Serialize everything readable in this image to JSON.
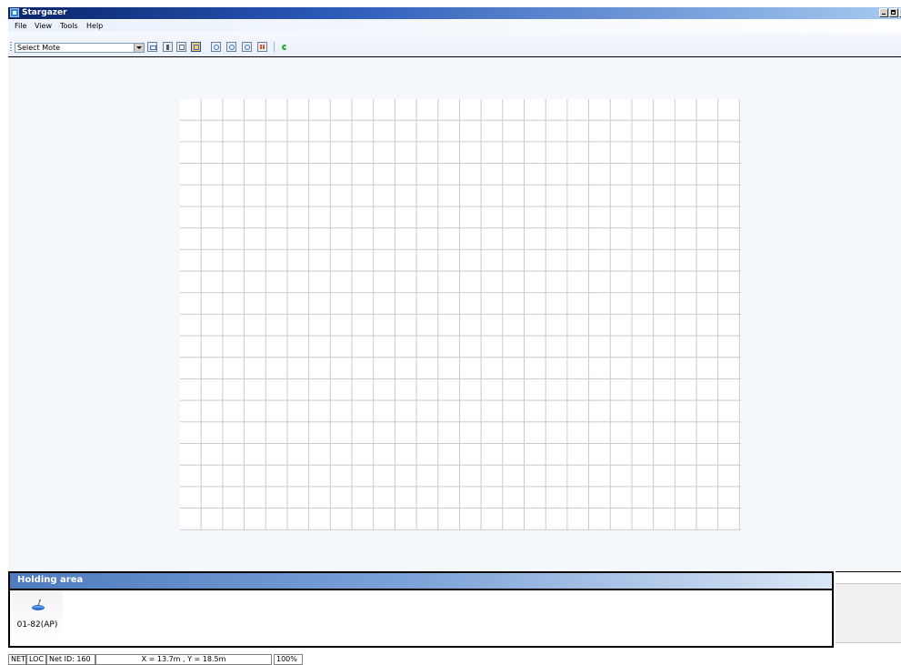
{
  "window": {
    "title": "Stargazer"
  },
  "menu": {
    "items": [
      "File",
      "View",
      "Tools",
      "Help"
    ]
  },
  "toolbar": {
    "select_value": "Select Mote",
    "buttons": [
      {
        "name": "rectangle-tool-icon",
        "color": "#4a6fb0"
      },
      {
        "name": "tower-icon",
        "color": "#5b5b5b"
      },
      {
        "name": "fit-view-icon",
        "color": "#6b6b6b"
      },
      {
        "name": "layout-icon",
        "color": "#3a78c2",
        "active": true
      },
      {
        "name": "zoom-in-icon",
        "color": "#3a78c2"
      },
      {
        "name": "zoom-out-icon",
        "color": "#3a78c2"
      },
      {
        "name": "zoom-fit-icon",
        "color": "#3a78c2"
      },
      {
        "name": "chart-icon",
        "color": "#d65a1f"
      },
      {
        "name": "refresh-icon",
        "color": "#2aa23a"
      }
    ]
  },
  "holding_area": {
    "title": "Holding area",
    "motes": [
      {
        "label": "01-82(AP)",
        "icon": "access-point-icon",
        "color": "#2d6fd0"
      }
    ]
  },
  "statusbar": {
    "net": "NET",
    "loc": "LOC",
    "net_id": "Net ID: 160",
    "coords": "X = 13.7m , Y = 18.5m",
    "zoom": "100%"
  },
  "colors": {
    "title_gradient_start": "#0a246a",
    "canvas_background": "#f4f8fc",
    "grid_line": "#c9c9c9",
    "holding_header": "#4f7bbf"
  }
}
